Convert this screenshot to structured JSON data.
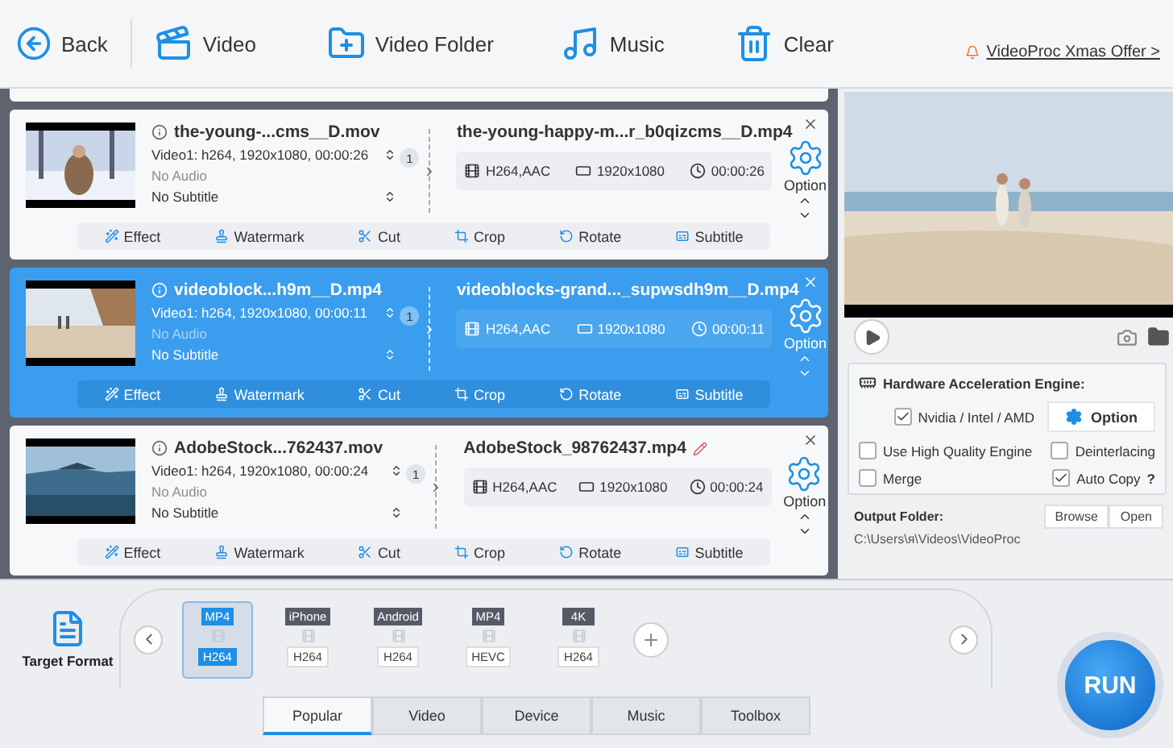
{
  "toolbar": {
    "back": "Back",
    "buttons": [
      {
        "kind": "video",
        "label": "Video"
      },
      {
        "kind": "folder",
        "label": "Video Folder"
      },
      {
        "kind": "music",
        "label": "Music"
      },
      {
        "kind": "clear",
        "label": "Clear"
      }
    ],
    "offer": "VideoProc Xmas Offer >"
  },
  "videos": [
    {
      "selected": false,
      "source": "the-young-...cms__D.mov",
      "video_track": "Video1: h264, 1920x1080, 00:00:26",
      "audio": "No Audio",
      "subtitle": "No Subtitle",
      "tracks": "1",
      "output": "the-young-happy-m...r_b0qizcms__D.mp4",
      "codec": "H264,AAC",
      "resolution": "1920x1080",
      "duration": "00:00:26",
      "option": "Option",
      "actions": [
        "Effect",
        "Watermark",
        "Cut",
        "Crop",
        "Rotate",
        "Subtitle"
      ]
    },
    {
      "selected": true,
      "source": "videoblock...h9m__D.mp4",
      "video_track": "Video1: h264, 1920x1080, 00:00:11",
      "audio": "No Audio",
      "subtitle": "No Subtitle",
      "tracks": "1",
      "output": "videoblocks-grand..._supwsdh9m__D.mp4",
      "codec": "H264,AAC",
      "resolution": "1920x1080",
      "duration": "00:00:11",
      "option": "Option",
      "actions": [
        "Effect",
        "Watermark",
        "Cut",
        "Crop",
        "Rotate",
        "Subtitle"
      ]
    },
    {
      "selected": false,
      "source": "AdobeStock...762437.mov",
      "video_track": "Video1: h264, 1920x1080, 00:00:24",
      "audio": "No Audio",
      "subtitle": "No Subtitle",
      "tracks": "1",
      "output": "AdobeStock_98762437.mp4",
      "codec": "H264,AAC",
      "resolution": "1920x1080",
      "duration": "00:00:24",
      "option": "Option",
      "actions": [
        "Effect",
        "Watermark",
        "Cut",
        "Crop",
        "Rotate",
        "Subtitle"
      ]
    }
  ],
  "settings": {
    "title": "Hardware Acceleration Engine:",
    "gpu": {
      "label": "Nvidia / Intel / AMD",
      "checked": true
    },
    "option": "Option",
    "options": [
      {
        "label": "Use High Quality Engine",
        "checked": false
      },
      {
        "label": "Deinterlacing",
        "checked": false
      },
      {
        "label": "Merge",
        "checked": false
      },
      {
        "label": "Auto Copy",
        "checked": true,
        "help": "?"
      }
    ],
    "output": {
      "label": "Output Folder:",
      "path": "C:\\Users\\я\\Videos\\VideoProc",
      "browse": "Browse",
      "open": "Open"
    }
  },
  "bottom": {
    "target_format": "Target Format",
    "formats": [
      {
        "badge": "MP4",
        "codec": "H264",
        "selected": true
      },
      {
        "badge": "iPhone",
        "codec": "H264",
        "selected": false
      },
      {
        "badge": "Android",
        "codec": "H264",
        "selected": false
      },
      {
        "badge": "MP4",
        "codec": "HEVC",
        "selected": false
      },
      {
        "badge": "4K",
        "codec": "H264",
        "selected": false
      }
    ],
    "tabs": [
      {
        "label": "Popular",
        "selected": true
      },
      {
        "label": "Video",
        "selected": false
      },
      {
        "label": "Device",
        "selected": false
      },
      {
        "label": "Music",
        "selected": false
      },
      {
        "label": "Toolbox",
        "selected": false
      }
    ],
    "run": "RUN"
  }
}
